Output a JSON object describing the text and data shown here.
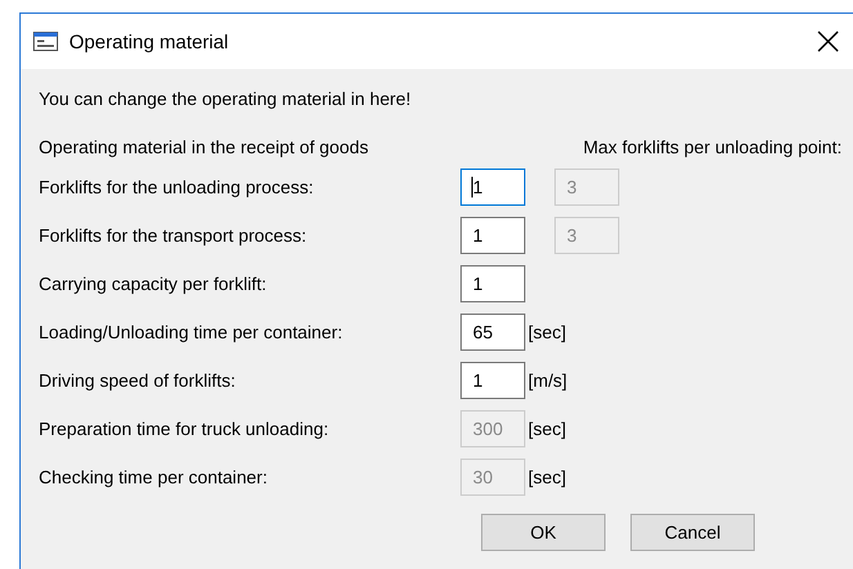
{
  "window": {
    "title": "Operating material"
  },
  "intro": "You can change the operating material in here!",
  "section_heading": "Operating material in the receipt of goods",
  "max_heading": "Max forklifts per unloading point:",
  "rows": [
    {
      "label": "Forklifts for the unloading process:",
      "value": "1",
      "disabled": false,
      "focused": true,
      "max": {
        "value": "3",
        "disabled": true
      }
    },
    {
      "label": "Forklifts for the transport process:",
      "value": "1",
      "disabled": false,
      "focused": false,
      "max": {
        "value": "3",
        "disabled": true
      }
    },
    {
      "label": "Carrying capacity per forklift:",
      "value": "1",
      "disabled": false,
      "focused": false
    },
    {
      "label": "Loading/Unloading time per container:",
      "value": "65",
      "disabled": false,
      "focused": false,
      "unit": "[sec]"
    },
    {
      "label": "Driving speed of forklifts:",
      "value": "1",
      "disabled": false,
      "focused": false,
      "unit": "[m/s]"
    },
    {
      "label": "Preparation time for truck unloading:",
      "value": "300",
      "disabled": true,
      "focused": false,
      "unit": "[sec]"
    },
    {
      "label": "Checking time per container:",
      "value": "30",
      "disabled": true,
      "focused": false,
      "unit": "[sec]"
    }
  ],
  "buttons": [
    "OK",
    "Cancel"
  ]
}
